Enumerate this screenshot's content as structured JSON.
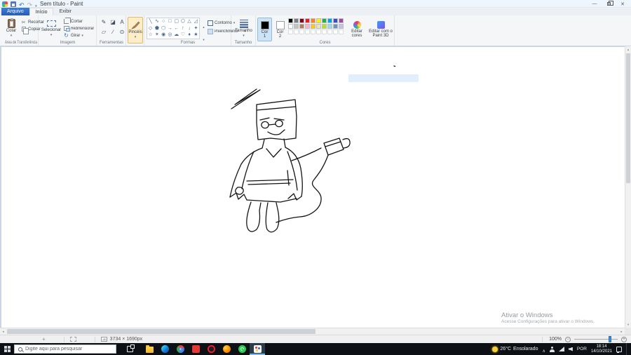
{
  "titlebar": {
    "title": "Sem título - Paint"
  },
  "tabs": {
    "file": "Arquivo",
    "home": "Início",
    "view": "Exibir"
  },
  "ribbon": {
    "clipboard": {
      "group": "Área de Transferência",
      "paste": "Colar",
      "cut": "Recortar",
      "copy": "Copiar"
    },
    "image": {
      "group": "Imagem",
      "select": "Selecionar",
      "crop": "Cortar",
      "resize": "Redimensionar",
      "rotate": "Girar"
    },
    "tools": {
      "group": "Ferramentas",
      "items": [
        {
          "name": "pencil",
          "glyph": "✎"
        },
        {
          "name": "fill",
          "glyph": "◪"
        },
        {
          "name": "text",
          "glyph": "A"
        },
        {
          "name": "eraser",
          "glyph": "▱"
        },
        {
          "name": "eyedropper",
          "glyph": "∕"
        },
        {
          "name": "magnifier",
          "glyph": "⊙"
        }
      ]
    },
    "brushes": {
      "label": "Pincéis"
    },
    "shapes": {
      "group": "Formas",
      "outline": "Contorno",
      "fill": "Preenchimento",
      "glyphs": [
        "╲",
        "∿",
        "○",
        "□",
        "▢",
        "⬠",
        "△",
        "◿",
        "◇",
        "⬟",
        "⬡",
        "→",
        "←",
        "↑",
        "↓",
        "✦",
        "☆",
        "✶",
        "◉",
        "◎",
        "☁",
        "♡",
        "♦",
        "★"
      ]
    },
    "size": {
      "group": "Tamanho",
      "label": "Tamanho"
    },
    "colors": {
      "group": "Cores",
      "color1_label": "Cor 1",
      "color2_label": "Cor 2",
      "color1_value": "#000000",
      "color2_value": "#ffffff",
      "edit_colors": "Editar cores",
      "edit_3d": "Editar com o Paint 3D",
      "palette": [
        [
          "#000000",
          "#7f7f7f",
          "#880015",
          "#ed1c24",
          "#ff7f27",
          "#fff200",
          "#22b14c",
          "#00a2e8",
          "#3f48cc",
          "#a349a4"
        ],
        [
          "#ffffff",
          "#c3c3c3",
          "#b97a57",
          "#ffaec9",
          "#ffc90e",
          "#efe4b0",
          "#b5e61d",
          "#99d9ea",
          "#7092be",
          "#c8bfe7"
        ]
      ],
      "empty_slots": 10
    }
  },
  "canvas": {
    "drawing_color": "#141414",
    "watermark": {
      "line1": "Ativar o Windows",
      "line2": "Acesse Configurações para ativar o Windows."
    },
    "drawing_paths": [
      "M328,88 L369,61 L333,82 L364,60",
      "M364,82 L419,75 L421,99 L420,130 L404,132 L384,130 L366,132 L364,108 L364,82",
      "M364,90 L420,85",
      "M369,104 L382,101 M389,102 L403,104",
      "M371,112 a5,4.5 0 1 0 10,-2 a5,4.5 0 1 0 -10,2",
      "M391,110 a5,4.5 0 1 0 10,-2 a5,4.5 0 1 0 -10,2",
      "M381,111 L391,110",
      "M380,121 q9,6 17,3 l7,-6",
      "M375,132 L372,144 M403,131 L405,143",
      "M372,144 Q352,151 342,167 Q331,190 326,214",
      "M326,214 l9,-6 l3,9 l8,-7 l4,8",
      "M350,218 L398,221 L421,216",
      "M405,143 Q423,152 427,173 Q431,197 428,213",
      "M428,213 l-7,5 l-4,-9 l-8,7",
      "M360,149 Q349,173 343,202",
      "M408,149 Q419,177 422,204",
      "M378,145 L388,157 L399,145",
      "M350,191 L416,189 M352,196 L412,194",
      "M408,176 L410,197",
      "M337,200 q-6,5 -1,9 q6,3 9,-3 q1,-7 -8,-6",
      "M414,162 Q437,154 456,144",
      "M460,137 L482,130 L488,146 L466,154 L460,137 M462,142 L484,135",
      "M487,132 q9,-4 10,3 q1,8 -9,9",
      "M466,154 C459,173 452,181 446,189 C437,199 455,203 456,215 C457,230 441,241 426,242 C413,243 400,247 392,250",
      "M356,221 Q347,247 351,258 Q355,267 364,260 Q370,252 368,233 L370,222",
      "M380,222 Q375,250 379,260 Q385,268 393,259 Q398,249 394,231 L392,222",
      "M560,27 l1.5,0.5"
    ]
  },
  "statusbar": {
    "canvas_size": "3734 × 1690px",
    "zoom": "100%",
    "zoom_out_glyph": "−",
    "zoom_in_glyph": "+"
  },
  "taskbar": {
    "search_placeholder": "Digite aqui para pesquisar",
    "weather_temp": "26°C",
    "weather_desc": "Ensolarado",
    "language": "POR",
    "time": "18:14",
    "date": "14/10/2021",
    "apps": [
      {
        "name": "file-explorer",
        "type": "folder"
      },
      {
        "name": "edge",
        "type": "edge"
      },
      {
        "name": "chrome",
        "type": "chrome"
      },
      {
        "name": "red-app",
        "type": "red"
      },
      {
        "name": "opera",
        "type": "opera"
      },
      {
        "name": "firefox",
        "type": "firefox"
      },
      {
        "name": "whatsapp",
        "type": "whatsapp"
      },
      {
        "name": "paint",
        "type": "paint",
        "active": true
      }
    ]
  }
}
